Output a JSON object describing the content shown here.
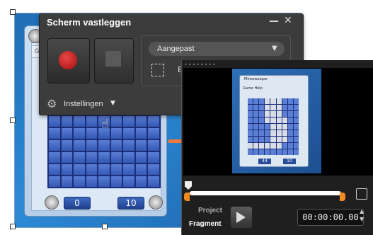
{
  "capture_panel": {
    "title": "Scherm vastleggen",
    "minimize": "—",
    "close": "✕",
    "capture_mode": "Aangepast",
    "dropdown_arrow": "▼",
    "region_label": "E",
    "settings_label": "Instellingen",
    "settings_arrow": "▼"
  },
  "minesweeper": {
    "tab_label": "G",
    "mine_counter": "0",
    "timer": "10"
  },
  "preview": {
    "window_title": "Minesweeper",
    "menu": "Game   Help",
    "mine_counter": "44",
    "timer": "10"
  },
  "editor": {
    "grip": "••••••••",
    "project_label": "Project",
    "fragment_label": "Fragment",
    "timecode": "00:00:00.00",
    "tc_up": "▲",
    "tc_down": "▼"
  },
  "colors": {
    "record": "#c81e1e",
    "timeline_handle": "#f28a20",
    "arrow": "#f07a3a"
  },
  "icons": [
    "record-icon",
    "stop-icon",
    "region-select-icon",
    "gear-icon",
    "close-icon",
    "minimize-icon",
    "hand-cursor-icon",
    "play-icon",
    "copy-icon"
  ]
}
